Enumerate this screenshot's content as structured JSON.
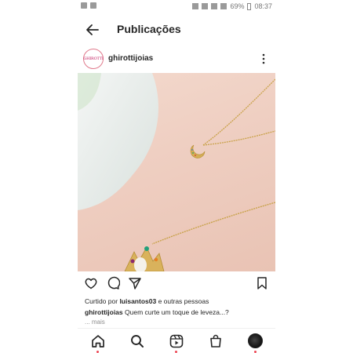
{
  "status_bar": {
    "battery": "69%",
    "time": "08:37"
  },
  "header": {
    "title": "Publicações",
    "back_icon": "arrow-left-icon"
  },
  "post": {
    "username": "ghirottijoias",
    "avatar_text": "GHIROTTI",
    "more_icon": "vertical-dots-icon",
    "liked_by_prefix": "Curtido por",
    "liked_by_user": "luisantos03",
    "liked_by_suffix": "e outras pessoas",
    "caption_user": "ghirottijoias",
    "caption_text": "Quem curte um toque de leveza...?",
    "more_label": "... mais"
  },
  "actions": {
    "like_icon": "heart-icon",
    "comment_icon": "comment-icon",
    "share_icon": "send-icon",
    "save_icon": "bookmark-icon"
  },
  "bottom_nav": {
    "items": [
      "home-icon",
      "search-icon",
      "reels-icon",
      "shop-icon",
      "profile-avatar"
    ]
  },
  "colors": {
    "accent_red": "#ed4956",
    "text": "#262626",
    "muted": "#8e8e8e"
  }
}
